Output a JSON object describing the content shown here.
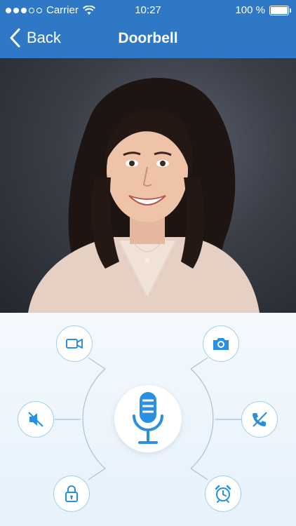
{
  "status_bar": {
    "carrier": "Carrier",
    "time": "10:27",
    "battery": "100 %",
    "signal_dots_filled": 3,
    "signal_dots_total": 5
  },
  "nav": {
    "back_label": "Back",
    "title": "Doorbell"
  },
  "colors": {
    "nav_bg": "#2f78c6",
    "accent": "#2a8fe0",
    "controls_bg": "#eaf3fb"
  },
  "controls": {
    "left": [
      "video-camera-icon",
      "speaker-mute-icon",
      "lock-icon"
    ],
    "right": [
      "camera-icon",
      "hang-up-phone-icon",
      "alarm-clock-icon"
    ],
    "center": "microphone-icon"
  }
}
